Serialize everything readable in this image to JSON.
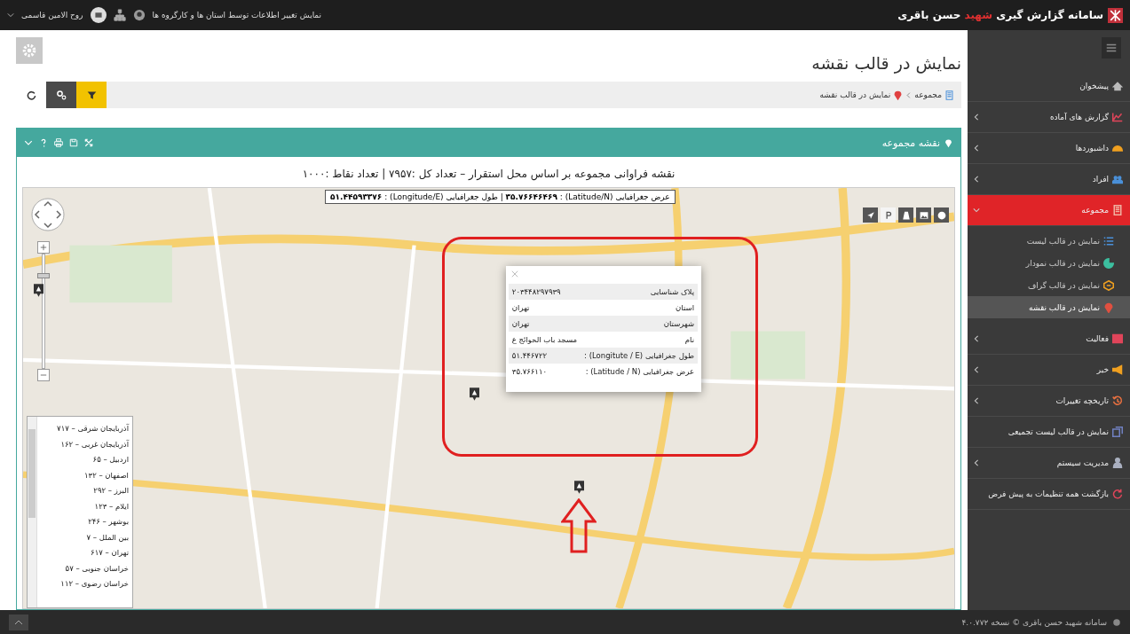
{
  "top_bar": {
    "brand": {
      "before": "سامانه گزارش گیری",
      "highlight": "شهید",
      "after": "حسن باقری"
    },
    "notice": "نمایش تغییر اطلاعات توسط استان ها و کارگروه ها",
    "user": "روح الامین قاسمی"
  },
  "sidebar": {
    "items": [
      {
        "label": "پیشخوان",
        "color": "#bbbbbb",
        "has_arrow": false,
        "expanded": false,
        "selected": false
      },
      {
        "label": "گزارش های آماده",
        "color": "#e0455a",
        "has_arrow": true,
        "expanded": false,
        "selected": false
      },
      {
        "label": "داشبوردها",
        "color": "#f0a020",
        "has_arrow": true,
        "expanded": false,
        "selected": false
      },
      {
        "label": "افراد",
        "color": "#4a90d9",
        "has_arrow": true,
        "expanded": false,
        "selected": false
      },
      {
        "label": "مجموعه",
        "color": "#f0b0a0",
        "has_arrow": true,
        "expanded": true,
        "selected": true,
        "children": [
          {
            "label": "نمایش در قالب لیست",
            "color": "#4a90d9",
            "selected": false
          },
          {
            "label": "نمایش در قالب نمودار",
            "color": "#3cc0a0",
            "selected": false
          },
          {
            "label": "نمایش در قالب گراف",
            "color": "#f0a020",
            "selected": false
          },
          {
            "label": "نمایش در قالب نقشه",
            "color": "#e05040",
            "selected": true
          }
        ]
      },
      {
        "label": "فعالیت",
        "color": "#e0455a",
        "has_arrow": true,
        "expanded": false,
        "selected": false
      },
      {
        "label": "خبر",
        "color": "#f0a020",
        "has_arrow": true,
        "expanded": false,
        "selected": false
      },
      {
        "label": "تاریخچه تغییرات",
        "color": "#e87040",
        "has_arrow": true,
        "expanded": false,
        "selected": false
      },
      {
        "label": "نمایش در قالب لیست تجمیعی",
        "color": "#7080c0",
        "has_arrow": false,
        "expanded": false,
        "selected": false
      },
      {
        "label": "مدیریت سیستم",
        "color": "#aab0c0",
        "has_arrow": true,
        "expanded": false,
        "selected": false
      },
      {
        "label": "بازگشت همه تنظیمات به پیش فرض",
        "color": "#e0455a",
        "has_arrow": false,
        "expanded": false,
        "selected": false
      }
    ]
  },
  "page": {
    "title": "نمایش در قالب نقشه",
    "breadcrumb": [
      {
        "label": "مجموعه"
      },
      {
        "label": "نمایش در قالب نقشه"
      }
    ]
  },
  "panel": {
    "title": "نقشه مجموعه",
    "map_title": "نقشه فراوانی مجموعه بر اساس محل استقرار – تعداد کل :۷۹۵۷ | تعداد نقاط :۱۰۰۰",
    "coordinates": "عرض جغرافیایی (Latitude/N) : **۳۵.۷۶۶۴۶۴۶۹** | طول جغرافیایی (Longitude/E) : **۵۱.۴۴۵۹۳۳۷۶**",
    "zoom": {
      "level": 0.82
    },
    "popup": [
      {
        "label": "پلاک شناسایی",
        "value": "۲۰۳۴۴۸۲۹۷۹۳۹"
      },
      {
        "label": "استان",
        "value": "تهران"
      },
      {
        "label": "شهرستان",
        "value": "تهران"
      },
      {
        "label": "نام",
        "value": "مسجد باب الحوائج ع"
      },
      {
        "label": "طول جغرافیایی (Longitute / E) :",
        "value": "۵۱.۴۴۶۷۲۲"
      },
      {
        "label": "عرض جغرافیایی (Latitude / N) :",
        "value": "۳۵.۷۶۶۱۱۰"
      }
    ],
    "legend": [
      "آذربایجان شرقی – ۷۱۷",
      "آذربایجان غربی – ۱۶۲",
      "اردبیل – ۶۵",
      "اصفهان – ۱۳۲",
      "البرز – ۲۹۲",
      "ایلام – ۱۲۳",
      "بوشهر – ۲۴۶",
      "بین الملل – ۷",
      "تهران – ۶۱۷",
      "خراسان جنوبی – ۵۷",
      "خراسان رضوی – ۱۱۲"
    ]
  },
  "footer": {
    "text": "سامانه شهید حسن باقری © نسخه ۴.۰.۷۷۲"
  }
}
